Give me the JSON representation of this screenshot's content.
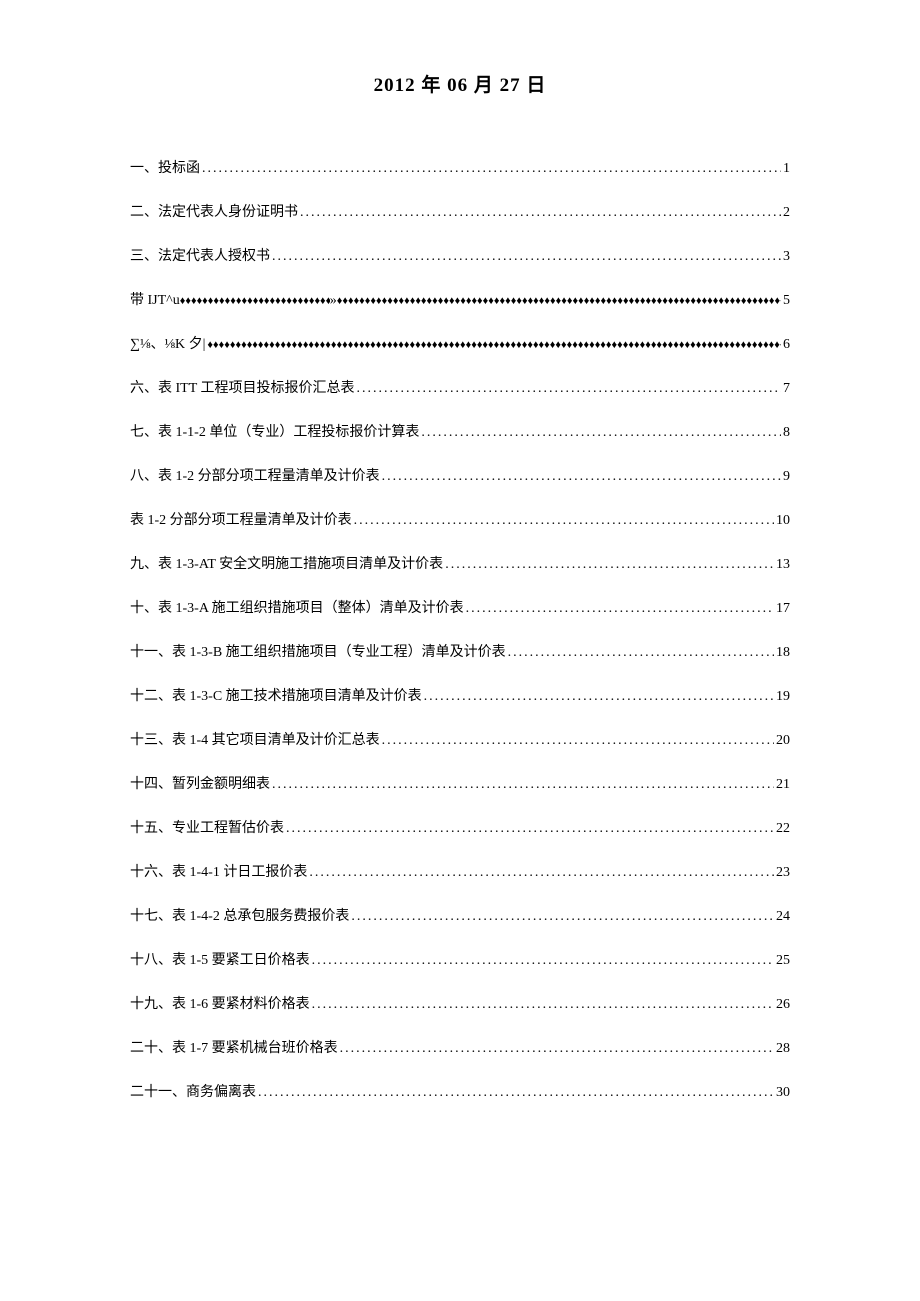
{
  "dateTitle": "2012 年 06 月 27 日",
  "toc": [
    {
      "label": "一、投标函",
      "page": "1",
      "style": "dots",
      "indent": false
    },
    {
      "label": "二、法定代表人身份证明书",
      "page": "2",
      "style": "dots",
      "indent": false
    },
    {
      "label": "三、法定代表人授权书",
      "page": "3",
      "style": "dots",
      "indent": false
    },
    {
      "label": "带 IJT^u",
      "mid": "»",
      "page": "5",
      "style": "diamonds-split",
      "indent": true
    },
    {
      "label": "∑⅛、⅛K 夕|",
      "page": "6",
      "style": "diamonds",
      "indent": false
    },
    {
      "label": "六、表 ITT 工程项目投标报价汇总表",
      "page": "7",
      "style": "dots",
      "indent": false
    },
    {
      "label": "七、表 1-1-2 单位（专业）工程投标报价计算表",
      "page": "8",
      "style": "dots",
      "indent": false
    },
    {
      "label": "八、表 1-2 分部分项工程量清单及计价表",
      "page": "9",
      "style": "dots",
      "indent": false
    },
    {
      "label": "表 1-2 分部分项工程量清单及计价表",
      "page": "10",
      "style": "dots",
      "indent": false
    },
    {
      "label": "九、表 1-3-AT 安全文明施工措施项目清单及计价表",
      "page": "13",
      "style": "dots",
      "indent": false
    },
    {
      "label": "十、表 1-3-A 施工组织措施项目（整体）清单及计价表",
      "page": "17",
      "style": "dots",
      "indent": false
    },
    {
      "label": "十一、表 1-3-B 施工组织措施项目（专业工程）清单及计价表",
      "page": "18",
      "style": "dots",
      "indent": false
    },
    {
      "label": "十二、表 1-3-C 施工技术措施项目清单及计价表",
      "page": "19",
      "style": "dots",
      "indent": false
    },
    {
      "label": "十三、表 1-4 其它项目清单及计价汇总表",
      "page": "20",
      "style": "dots",
      "indent": false
    },
    {
      "label": "十四、暂列金额明细表",
      "page": "21",
      "style": "dots",
      "indent": false
    },
    {
      "label": "十五、专业工程暂估价表",
      "page": "22",
      "style": "dots",
      "indent": false
    },
    {
      "label": "十六、表 1-4-1 计日工报价表",
      "page": "23",
      "style": "dots",
      "indent": false
    },
    {
      "label": "十七、表 1-4-2 总承包服务费报价表",
      "page": "24",
      "style": "dots",
      "indent": false
    },
    {
      "label": "十八、表 1-5 要紧工日价格表",
      "page": "25",
      "style": "dots",
      "indent": false
    },
    {
      "label": "十九、表 1-6 要紧材料价格表",
      "page": "26",
      "style": "dots",
      "indent": false
    },
    {
      "label": "二十、表 1-7 要紧机械台班价格表",
      "page": "28",
      "style": "dots",
      "indent": false
    },
    {
      "label": "二十一、商务偏离表",
      "page": "30",
      "style": "dots",
      "indent": false
    }
  ]
}
